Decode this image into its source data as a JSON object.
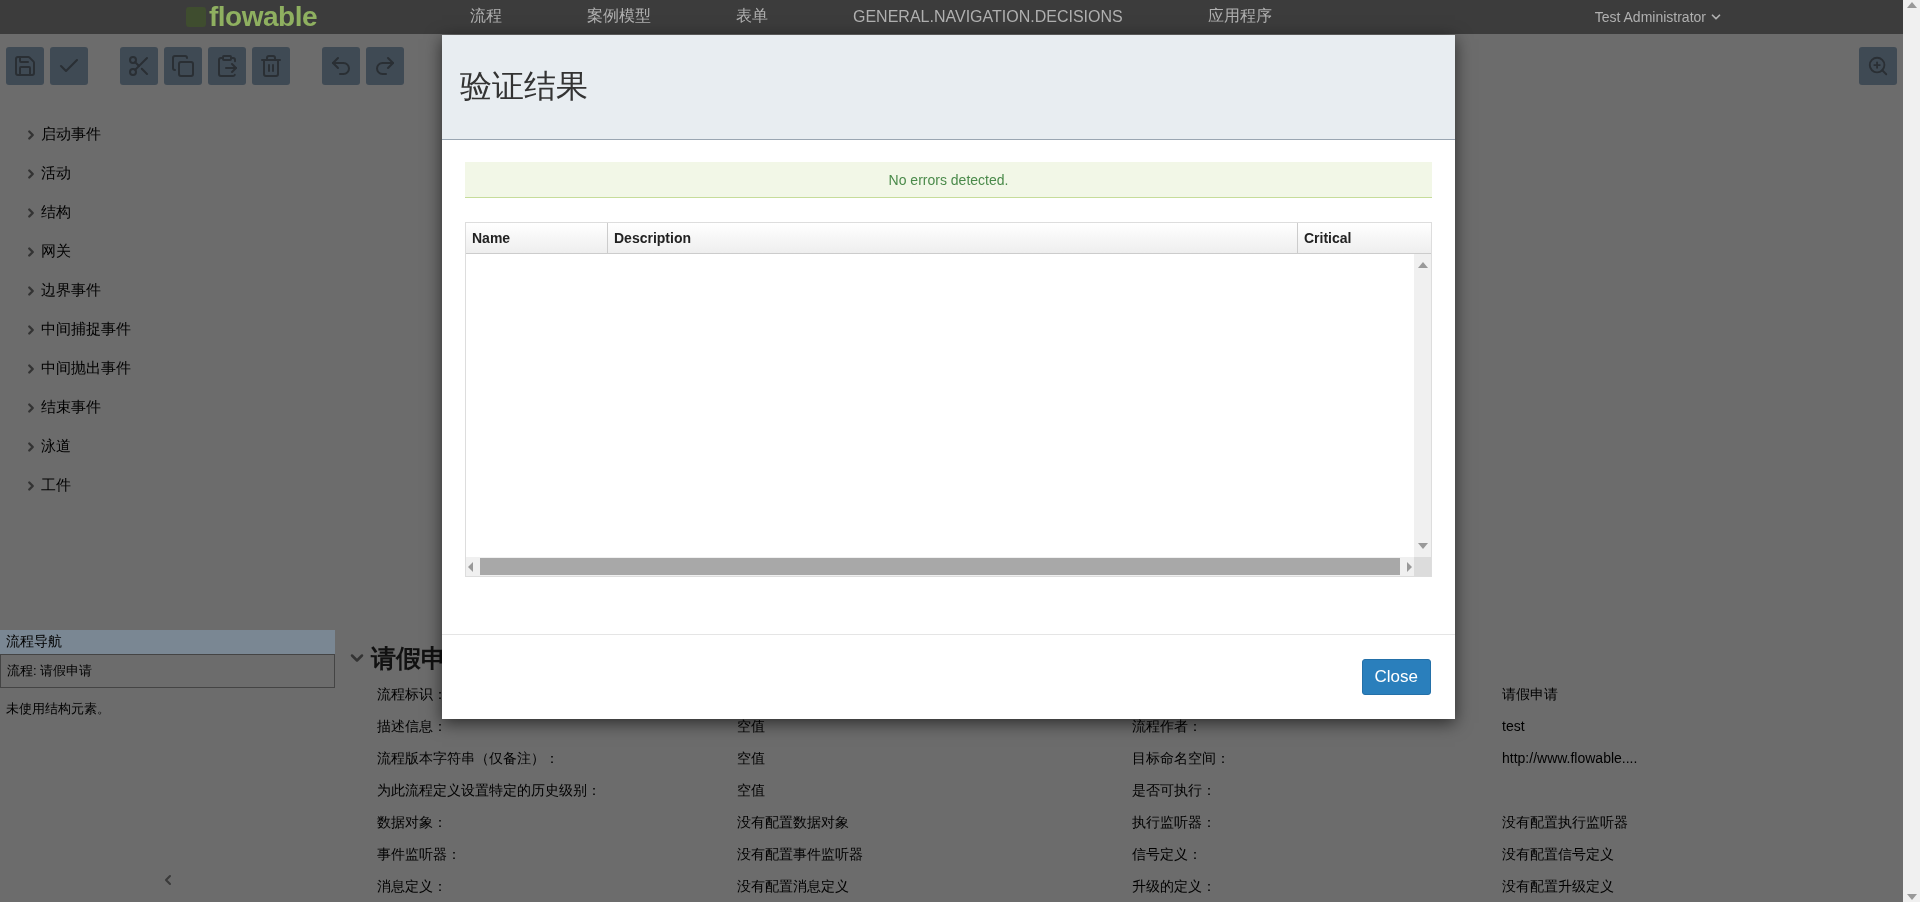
{
  "navbar": {
    "logo": "flowable",
    "items": [
      "流程",
      "案例模型",
      "表单",
      "GENERAL.NAVIGATION.DECISIONS",
      "应用程序"
    ],
    "user": "Test Administrator"
  },
  "palette": {
    "groups": [
      "启动事件",
      "活动",
      "结构",
      "网关",
      "边界事件",
      "中间捕捉事件",
      "中间抛出事件",
      "结束事件",
      "泳道",
      "工件"
    ]
  },
  "navigator": {
    "title": "流程导航",
    "process": "流程: 请假申请",
    "note": "未使用结构元素。"
  },
  "properties": {
    "heading": "请假申",
    "left": [
      {
        "label": "流程标识："
      },
      {
        "label": "描述信息：",
        "value": "空值"
      },
      {
        "label": "流程版本字符串（仅备注）：",
        "value": "空值"
      },
      {
        "label": "为此流程定义设置特定的历史级别：",
        "value": "空值"
      },
      {
        "label": "数据对象：",
        "value": "没有配置数据对象"
      },
      {
        "label": "事件监听器：",
        "value": "没有配置事件监听器"
      },
      {
        "label": "消息定义：",
        "value": "没有配置消息定义"
      }
    ],
    "right": [
      {
        "value": "请假申请"
      },
      {
        "label": "流程作者：",
        "value": "test"
      },
      {
        "label": "目标命名空间：",
        "value": "http://www.flowable...."
      },
      {
        "label": "是否可执行："
      },
      {
        "label": "执行监听器：",
        "value": "没有配置执行监听器"
      },
      {
        "label": "信号定义：",
        "value": "没有配置信号定义"
      },
      {
        "label": "升级的定义：",
        "value": "没有配置升级定义"
      }
    ]
  },
  "dialog": {
    "title": "验证结果",
    "alert": "No errors detected.",
    "columns": [
      "Name",
      "Description",
      "Critical"
    ],
    "close_button": "Close"
  }
}
